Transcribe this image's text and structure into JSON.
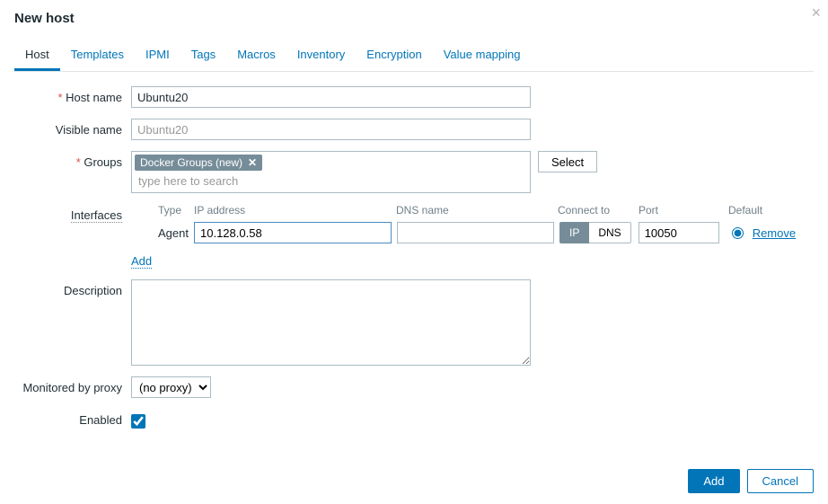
{
  "modal": {
    "title": "New host",
    "close_label": "×"
  },
  "tabs": {
    "host": "Host",
    "templates": "Templates",
    "ipmi": "IPMI",
    "tags": "Tags",
    "macros": "Macros",
    "inventory": "Inventory",
    "encryption": "Encryption",
    "value_mapping": "Value mapping"
  },
  "labels": {
    "host_name": "Host name",
    "visible_name": "Visible name",
    "groups": "Groups",
    "interfaces": "Interfaces",
    "description": "Description",
    "monitored_by_proxy": "Monitored by proxy",
    "enabled": "Enabled"
  },
  "form": {
    "host_name_value": "Ubuntu20",
    "visible_name_placeholder": "Ubuntu20",
    "groups_tag": "Docker Groups (new)",
    "groups_search_placeholder": "type here to search",
    "select_btn": "Select"
  },
  "interfaces": {
    "headers": {
      "type": "Type",
      "ip": "IP address",
      "dns": "DNS name",
      "connect": "Connect to",
      "port": "Port",
      "default": "Default"
    },
    "row": {
      "type": "Agent",
      "ip_value": "10.128.0.58",
      "connect_ip": "IP",
      "connect_dns": "DNS",
      "port_value": "10050",
      "remove": "Remove"
    },
    "add_link": "Add"
  },
  "proxy": {
    "selected": "(no proxy)"
  },
  "footer": {
    "add": "Add",
    "cancel": "Cancel"
  }
}
